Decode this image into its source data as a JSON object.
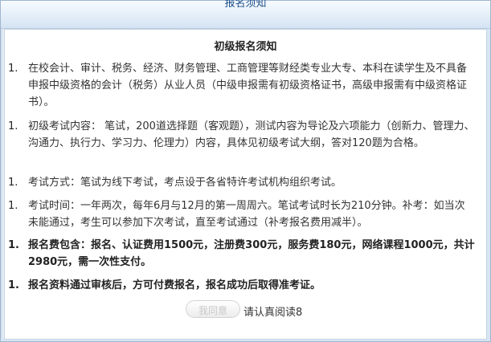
{
  "dialog": {
    "title": "报名须知"
  },
  "notice": {
    "heading": "初级报名须知",
    "items": [
      {
        "num": "1.",
        "text": "在校会计、审计、税务、经济、财务管理、工商管理等财经类专业大专、本科在读学生及不具备申报中级资格的会计（税务）从业人员（中级申报需有初级资格证书，高级申报需有中级资格证书）。"
      },
      {
        "num": "1.",
        "text": "初级考试内容： 笔试，200道选择题（客观题），测试内容为导论及六项能力（创新力、管理力、沟通力、执行力、学习力、伦理力）内容，具体见初级考试大纲，答对120题为合格。"
      },
      {
        "num": "1.",
        "text": "考试方式：笔试为线下考试，考点设于各省特许考试机构组织考试。"
      },
      {
        "num": "1.",
        "text": "考试时间：一年两次，每年6月与12月的第一周周六。笔试考试时长为210分钟。补考：如当次未能通过，考生可以参加下次考试，直至考试通过（补考报名费用减半）。"
      },
      {
        "num": "1.",
        "text": "报名费包含：报名、认证费用1500元，注册费300元，服务费180元，网络课程1000元，共计2980元，需一次性支付。"
      },
      {
        "num": "1.",
        "text": "报名资料通过审核后，方可付费报名，报名成功后取得准考证。"
      }
    ]
  },
  "footer": {
    "read_button_label": "我同意",
    "countdown_text": "请认真阅读8"
  },
  "colors": {
    "title_text": "#1f4f8a",
    "frame_border": "#9fb6cf",
    "body_text": "#333333",
    "button_disabled_text": "#c8c8c8"
  }
}
